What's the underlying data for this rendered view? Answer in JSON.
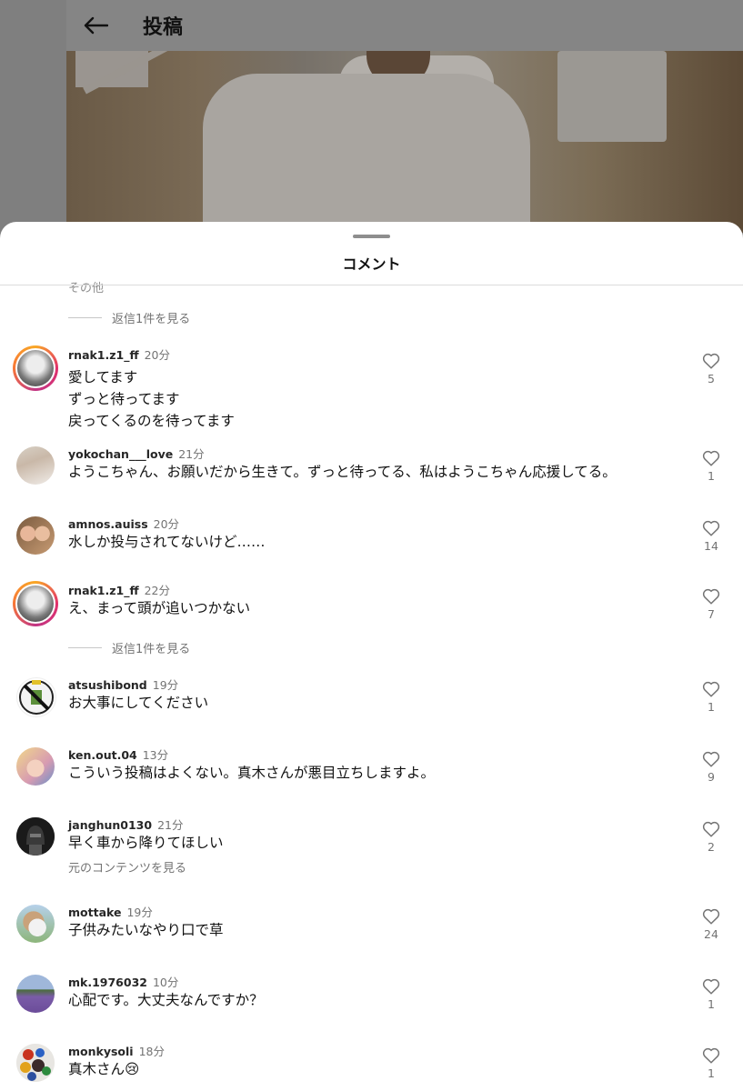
{
  "header": {
    "title": "投稿"
  },
  "sheet": {
    "title": "コメント",
    "truncated_text": "その他"
  },
  "comments": [
    {
      "id": "c1",
      "username": "rnak1.z1_ff",
      "time": "20分",
      "lines": [
        "愛してます",
        "ずっと待ってます",
        "戻ってくるのを待ってます"
      ],
      "likes": "5"
    },
    {
      "id": "c2",
      "username": "yokochan___love",
      "time": "21分",
      "lines": [
        "ようこちゃん、お願いだから生きて。ずっと待ってる、私はようこちゃん応援してる。"
      ],
      "likes": "1"
    },
    {
      "id": "c3",
      "username": "amnos.auiss",
      "time": "20分",
      "lines": [
        "水しか投与されてないけど……"
      ],
      "likes": "14"
    },
    {
      "id": "c4",
      "username": "rnak1.z1_ff",
      "time": "22分",
      "lines": [
        "え、まって頭が追いつかない"
      ],
      "likes": "7"
    },
    {
      "id": "c5",
      "username": "atsushibond",
      "time": "19分",
      "lines": [
        "お大事にしてください"
      ],
      "likes": "1"
    },
    {
      "id": "c6",
      "username": "ken.out.04",
      "time": "13分",
      "lines": [
        "こういう投稿はよくない。真木さんが悪目立ちしますよ。"
      ],
      "likes": "9"
    },
    {
      "id": "c7",
      "username": "janghun0130",
      "time": "21分",
      "lines": [
        "早く車から降りてほしい"
      ],
      "likes": "2",
      "subtext": "元のコンテンツを見る"
    },
    {
      "id": "c8",
      "username": "mottake",
      "time": "19分",
      "lines": [
        "子供みたいなやり口で草"
      ],
      "likes": "24"
    },
    {
      "id": "c9",
      "username": "mk.1976032",
      "time": "10分",
      "lines": [
        "心配です。大丈夫なんですか？"
      ],
      "likes": "1"
    },
    {
      "id": "c10",
      "username": "monkysoli",
      "time": "18分",
      "lines": [
        "真木さん😢"
      ],
      "likes": "1"
    }
  ],
  "replies": {
    "label": "返信1件を見る"
  }
}
